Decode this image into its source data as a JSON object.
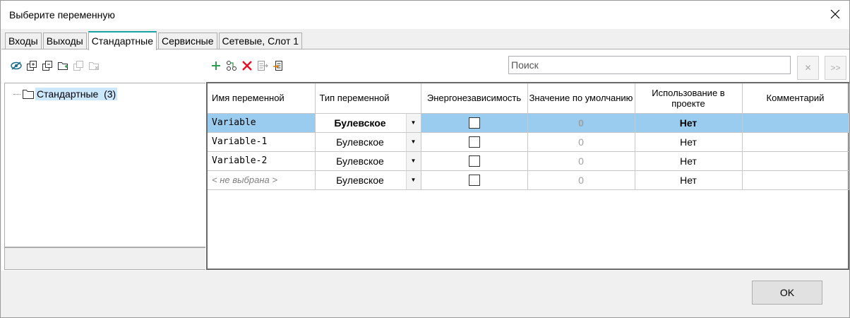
{
  "window": {
    "title": "Выберите переменную"
  },
  "tabs": [
    {
      "label": "Входы"
    },
    {
      "label": "Выходы"
    },
    {
      "label": "Стандартные",
      "active": true
    },
    {
      "label": "Сервисные"
    },
    {
      "label": "Сетевые, Слот 1"
    }
  ],
  "search": {
    "placeholder": "Поиск",
    "value": ""
  },
  "toolbar": {
    "left_icons": [
      "hide-icon",
      "copy-icon",
      "duplicate-icon",
      "add-folder-icon",
      "paste-icon",
      "delete-folder-icon"
    ],
    "mid_icons": [
      "add-icon",
      "link-variables-icon",
      "delete-icon",
      "export-icon",
      "import-icon"
    ],
    "search_clear": "✕",
    "search_next": ">>"
  },
  "tree": {
    "root_label": "Стандартные",
    "root_count": "(3)"
  },
  "table": {
    "columns": [
      "Имя переменной",
      "Тип переменной",
      "Энергонезависимость",
      "Значение по умолчанию",
      "Использование в проекте",
      "Комментарий"
    ],
    "rows": [
      {
        "name": "Variable",
        "type": "Булевское",
        "retain": false,
        "default": "0",
        "usage": "Нет",
        "comment": "",
        "selected": true
      },
      {
        "name": "Variable-1",
        "type": "Булевское",
        "retain": false,
        "default": "0",
        "usage": "Нет",
        "comment": ""
      },
      {
        "name": "Variable-2",
        "type": "Булевское",
        "retain": false,
        "default": "0",
        "usage": "Нет",
        "comment": ""
      },
      {
        "name": "< не выбрана >",
        "type": "Булевское",
        "retain": false,
        "default": "0",
        "usage": "Нет",
        "comment": "",
        "placeholder": true
      }
    ]
  },
  "footer": {
    "ok_label": "OK"
  },
  "colors": {
    "accent": "#1aa3a3",
    "selection": "#99ccee",
    "tree_selection": "#cce8ff",
    "delete_red": "#e81123",
    "add_green": "#2e9e4f"
  }
}
